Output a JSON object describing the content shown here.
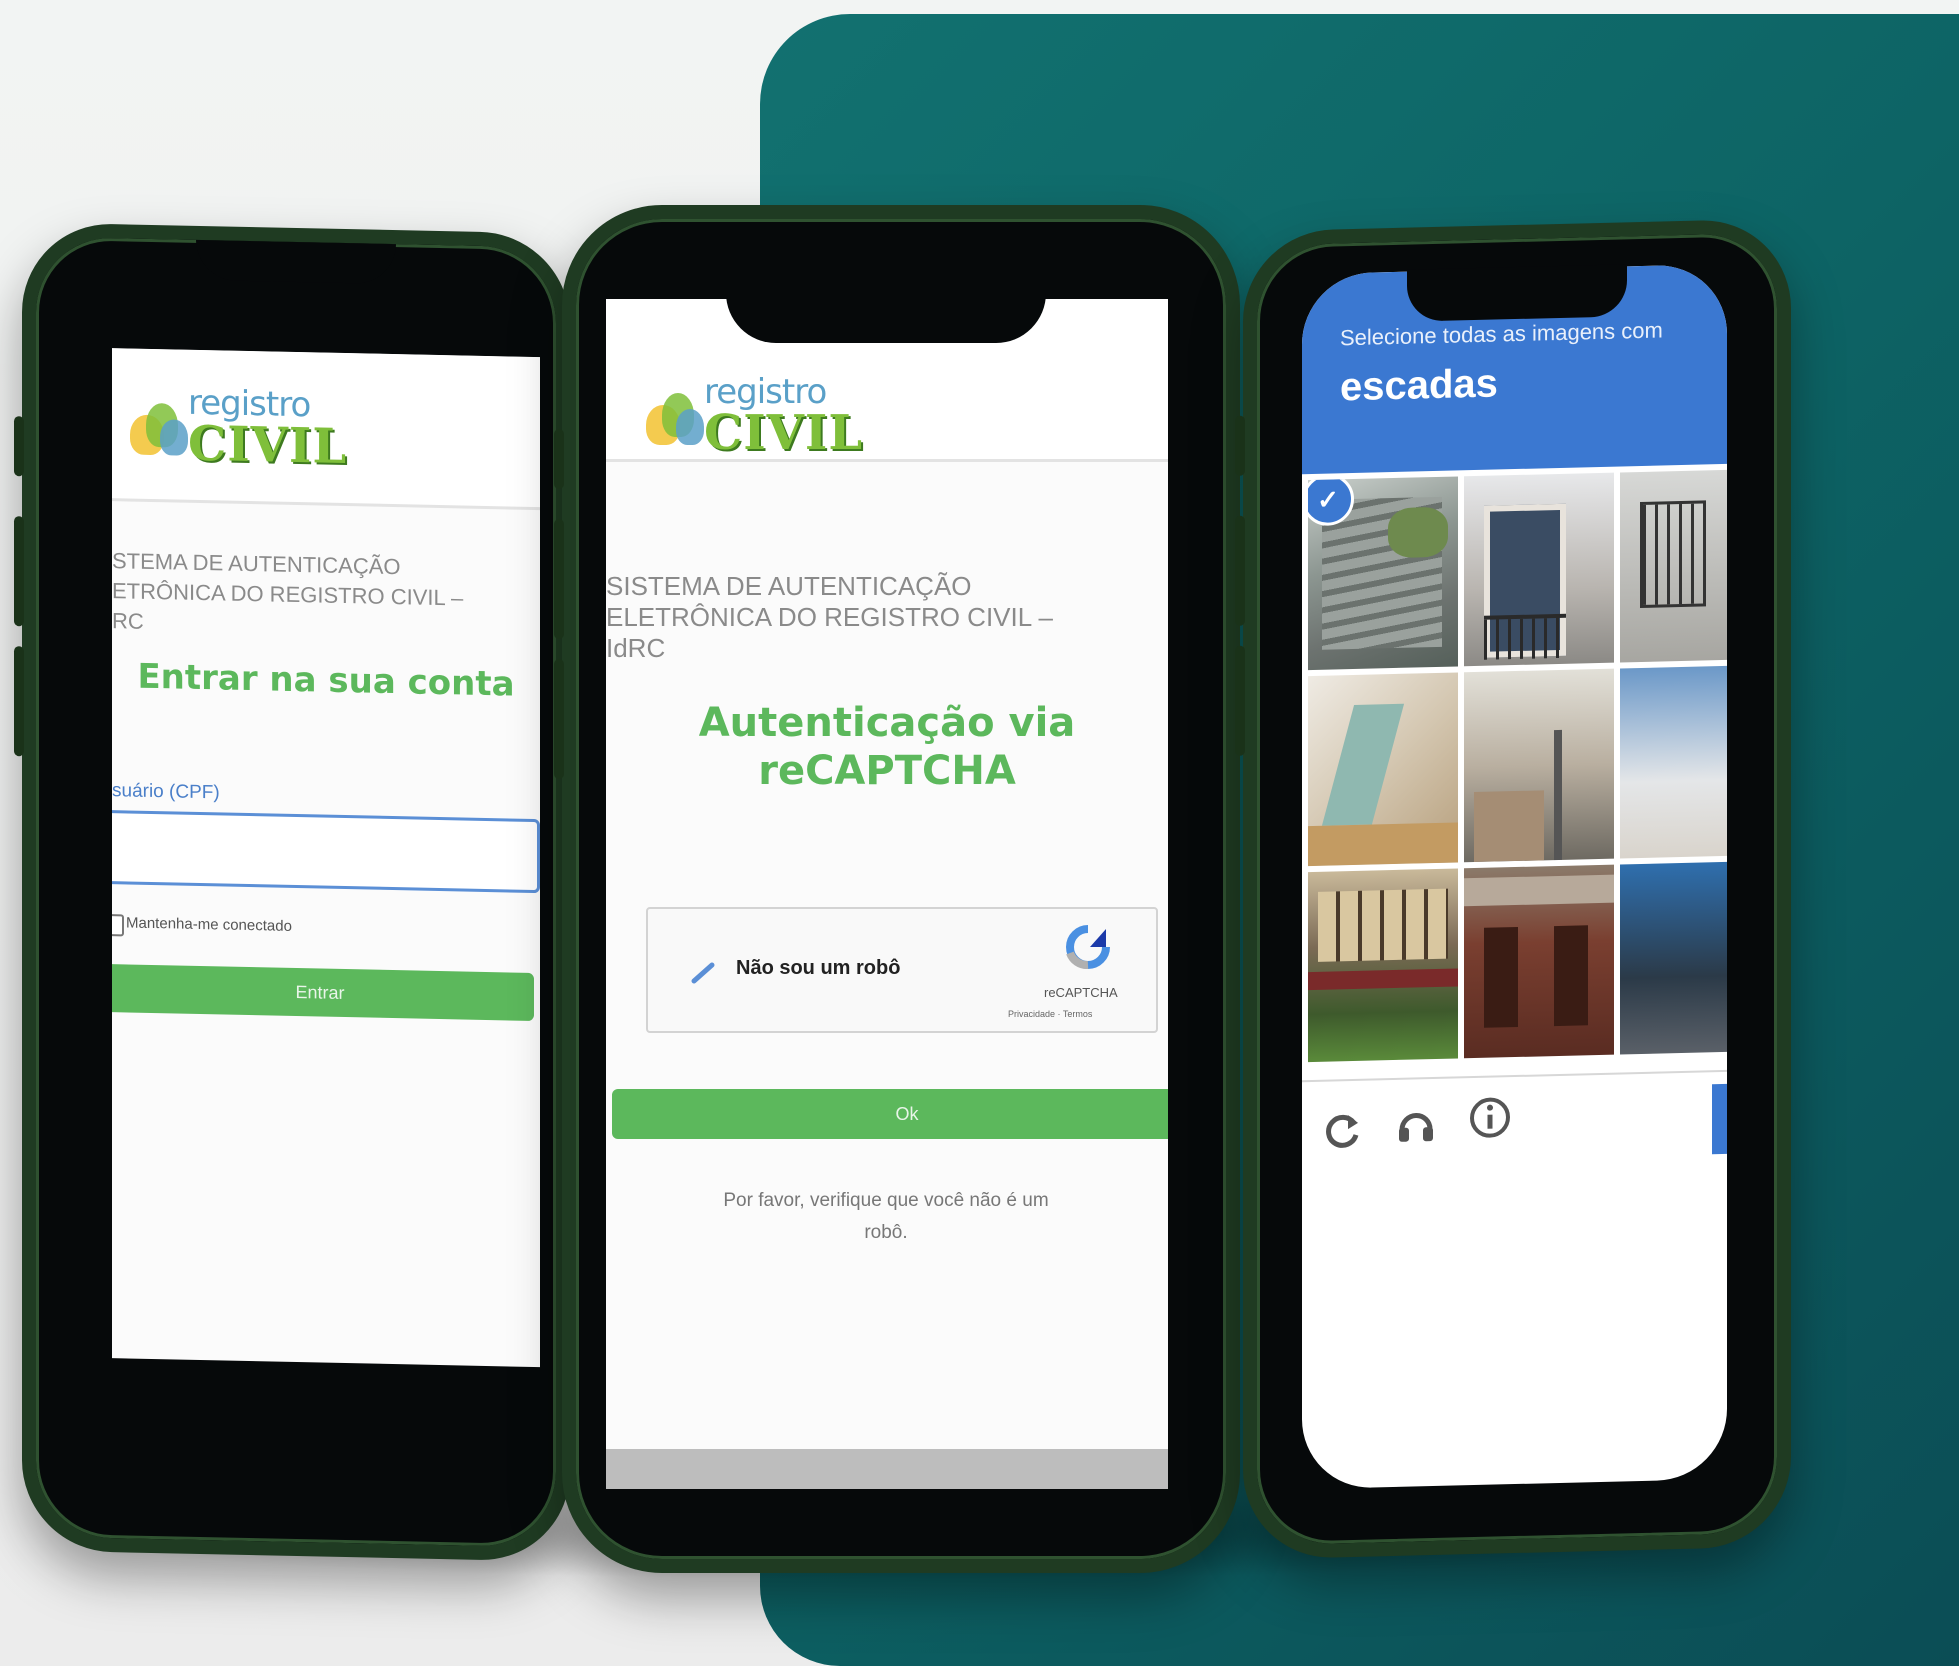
{
  "colors": {
    "teal": "#0d6465",
    "brand_green": "#5cb85c",
    "recaptcha_blue": "#3b78d1",
    "phone_frame": "#1f3b22"
  },
  "logo": {
    "top": "registro",
    "bottom": "CIVIL"
  },
  "phone1": {
    "system_title": "STEMA DE AUTENTICAÇÃO\nETRÔNICA DO REGISTRO CIVIL –\nRC",
    "heading": "Entrar na sua conta",
    "user_label": "suário (CPF)",
    "user_value": "",
    "keep_connected": "Mantenha-me conectado",
    "submit": "Entrar"
  },
  "phone2": {
    "system_title": "SISTEMA DE AUTENTICAÇÃO\nELETRÔNICA DO REGISTRO CIVIL –\nIdRC",
    "heading_line1": "Autenticação via",
    "heading_line2": "reCAPTCHA",
    "recaptcha_label": "Não sou um robô",
    "recaptcha_brand": "reCAPTCHA",
    "recaptcha_links": "Privacidade · Termos",
    "ok_button": "Ok",
    "verify_message": "Por favor, verifique que você não é um\nrobô."
  },
  "phone3": {
    "instruction": "Selecione todas as imagens com",
    "target_word": "escadas",
    "icons": [
      "reload-icon",
      "headphones-icon",
      "info-icon"
    ]
  }
}
